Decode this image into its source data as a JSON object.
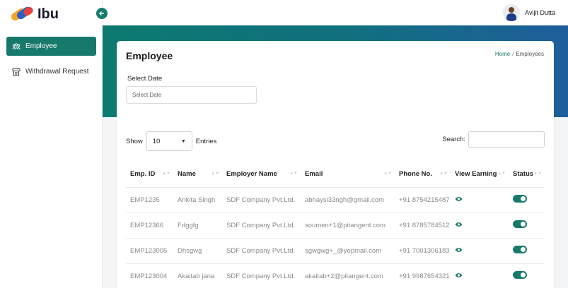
{
  "app": {
    "logo_text": "Ibu"
  },
  "sidebar": {
    "items": [
      {
        "label": "Employee",
        "icon": "users-icon",
        "active": true
      },
      {
        "label": "Withdrawal Request",
        "icon": "receipt-icon",
        "active": false
      }
    ],
    "collapse_icon": "arrow-left-icon"
  },
  "topbar": {
    "user_name": "Avijit Dutta"
  },
  "page": {
    "title": "Employee",
    "breadcrumb": {
      "home": "Home",
      "separator": "/",
      "current": "Employees"
    },
    "date_filter": {
      "label": "Select Date",
      "placeholder": "Select Date"
    },
    "entries": {
      "show_label": "Show",
      "value": "10",
      "suffix": "Entries"
    },
    "search": {
      "label": "Search:"
    }
  },
  "table": {
    "columns": [
      "Emp. ID",
      "Name",
      "Employer Name",
      "Email",
      "Phone No.",
      "View Earning",
      "Status"
    ],
    "rows": [
      {
        "id": "EMP1235",
        "name": "Ankita Singh",
        "employer": "SDF Company Pvt.Ltd.",
        "email": "abhaysi33ngh@gmail.com",
        "phone": "+91 8754215487",
        "status_on": true
      },
      {
        "id": "EMP12366",
        "name": "Fdggfg",
        "employer": "SDF Company Pvt.Ltd.",
        "email": "soumen+1@pitangent.com",
        "phone": "+91 8785784512",
        "status_on": true
      },
      {
        "id": "EMP123005",
        "name": "Dhsgwg",
        "employer": "SDF Company Pvt.Ltd.",
        "email": "sgwgwg+_@yopmail.com",
        "phone": "+91 7001306183",
        "status_on": true
      },
      {
        "id": "EMP123004",
        "name": "Akaitab jana",
        "employer": "SDF Company Pvt.Ltd.",
        "email": "akaitab+2@pitangent.com",
        "phone": "+91 9987654321",
        "status_on": true
      }
    ]
  },
  "colors": {
    "accent": "#17796c",
    "hero_start": "#0d7a70",
    "hero_end": "#1f5e9c"
  }
}
